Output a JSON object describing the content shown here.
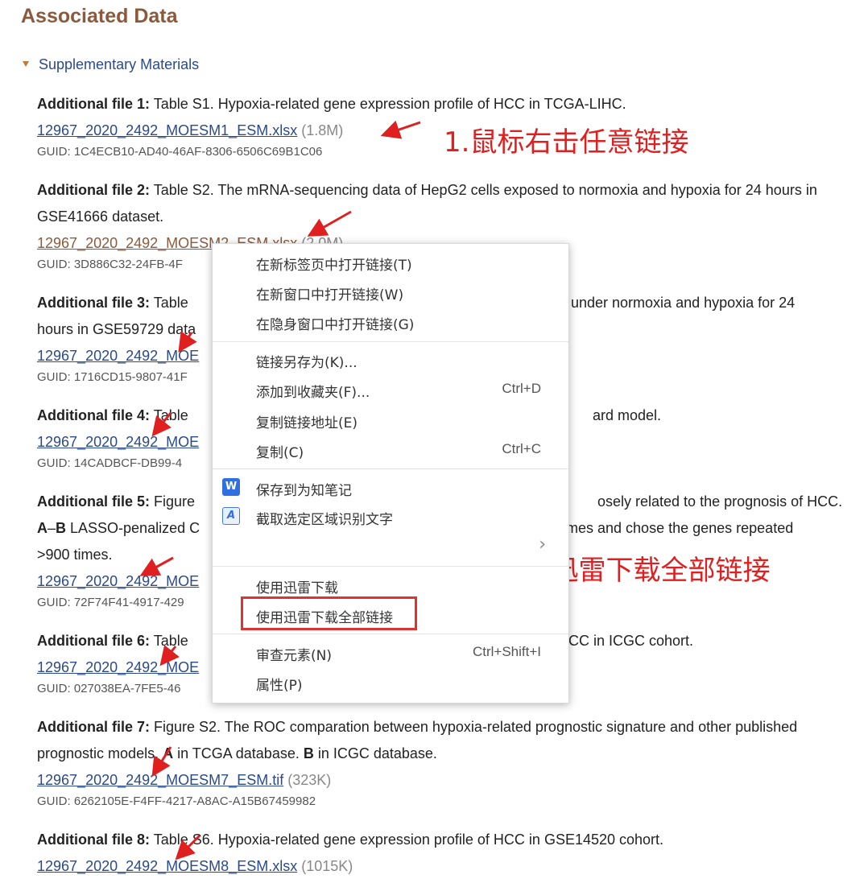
{
  "page": {
    "title": "Associated Data"
  },
  "section": {
    "label": "Supplementary Materials"
  },
  "files": [
    {
      "label": "Additional file 1:",
      "desc": " Table S1. Hypoxia-related gene expression profile of HCC in TCGA-LIHC.",
      "link": "12967_2020_2492_MOESM1_ESM.xlsx",
      "size": "(1.8M)",
      "guid": "GUID: 1C4ECB10-AD40-46AF-8306-6506C69B1C06"
    },
    {
      "label": "Additional file 2:",
      "desc": " Table S2. The mRNA-sequencing data of HepG2 cells exposed to normoxia and hypoxia for 24 hours in GSE41666 dataset.",
      "link": "12967_2020_2492_MOESM2_ESM.xlsx",
      "size": "(2.0M)",
      "guid": "GUID: 3D886C32-24FB-4F"
    },
    {
      "label": "Additional file 3:",
      "desc_a": " Table",
      "desc_b": "under normoxia and hypoxia for 24",
      "desc_c": "hours in GSE59729 data",
      "link": "12967_2020_2492_MOE",
      "guid": "GUID: 1716CD15-9807-41F"
    },
    {
      "label": "Additional file 4:",
      "desc_a": " Table",
      "desc_b": "ard model.",
      "link": "12967_2020_2492_MOE",
      "guid": "GUID: 14CADBCF-DB99-4"
    },
    {
      "label": "Additional file 5:",
      "desc_a": " Figure",
      "desc_b": "osely related to the prognosis of HCC.",
      "desc_c1": "A",
      "desc_c2": "–",
      "desc_c3": "B",
      "desc_c4": " LASSO-penalized C",
      "desc_d": "0 times and chose the genes repeated",
      "desc_e": ">900 times.",
      "link": "12967_2020_2492_MOE",
      "guid": "GUID: 72F74F41-4917-429"
    },
    {
      "label": "Additional file 6:",
      "desc_a": " Table",
      "desc_b": "CC in ICGC cohort.",
      "link": "12967_2020_2492_MOE",
      "guid": "GUID: 027038EA-7FE5-46"
    },
    {
      "label": "Additional file 7:",
      "desc_1": " Figure S2. The ROC comparation between hypoxia-related prognostic signature and other published prognostic models. ",
      "desc_2": "A",
      "desc_3": " in TCGA database. ",
      "desc_4": "B",
      "desc_5": " in ICGC database.",
      "link": "12967_2020_2492_MOESM7_ESM.tif",
      "size": "(323K)",
      "guid": "GUID: 6262105E-F4FF-4217-A8AC-A15B67459982"
    },
    {
      "label": "Additional file 8:",
      "desc": " Table S6. Hypoxia-related gene expression profile of HCC in GSE14520 cohort.",
      "link": "12967_2020_2492_MOESM8_ESM.xlsx",
      "size": "(1015K)"
    }
  ],
  "annotations": {
    "step1": "1.鼠标右击任意链接",
    "step2": "2.使用迅雷下载全部链接"
  },
  "context_menu": {
    "open_new_tab": "在新标签页中打开链接(T)",
    "open_new_window": "在新窗口中打开链接(W)",
    "open_incognito": "在隐身窗口中打开链接(G)",
    "save_link_as": "链接另存为(K)...",
    "add_favorite": "添加到收藏夹(F)...",
    "add_favorite_shortcut": "Ctrl+D",
    "copy_link": "复制链接地址(E)",
    "copy": "复制(C)",
    "copy_shortcut": "Ctrl+C",
    "save_note": "保存到为知笔记",
    "save_note_icon": "W",
    "ocr": "截取选定区域识别文字",
    "ocr_icon": "A",
    "thunder_download": "使用迅雷下载",
    "thunder_download_all": "使用迅雷下载全部链接",
    "inspect": "审查元素(N)",
    "inspect_shortcut": "Ctrl+Shift+I",
    "properties": "属性(P)"
  },
  "colors": {
    "title": "#8b5a3c",
    "link": "#2a4a8c",
    "annotation": "#e02020"
  }
}
